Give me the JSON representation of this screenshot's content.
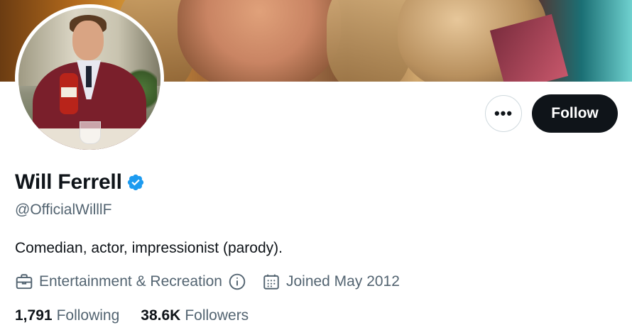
{
  "profile": {
    "name": "Will Ferrell",
    "handle": "@OfficialWilllF",
    "bio": "Comedian, actor, impressionist (parody).",
    "verified": true,
    "category": "Entertainment & Recreation",
    "joined": "Joined May 2012"
  },
  "actions": {
    "more_label": "•••",
    "follow_label": "Follow"
  },
  "stats": {
    "following_count": "1,791",
    "following_label": "Following",
    "followers_count": "38.6K",
    "followers_label": "Followers"
  },
  "icons": {
    "verified": "verified-badge-icon",
    "category": "briefcase-icon",
    "info": "info-icon",
    "joined": "calendar-icon"
  },
  "colors": {
    "verified_blue": "#1d9bf0",
    "follow_bg": "#0f1419",
    "secondary_text": "#536471",
    "primary_text": "#0f1419"
  }
}
